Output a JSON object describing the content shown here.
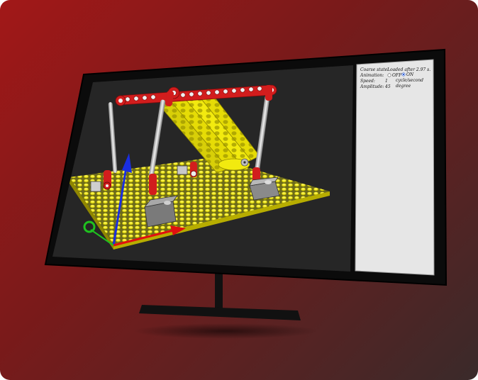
{
  "panel": {
    "status_label": "Coarse state:",
    "status_value": "Loaded after 2.97 s.",
    "animation_label": "Animation:",
    "animation_off": "OFF",
    "animation_on": "ON",
    "animation_selected": "ON",
    "speed_label": "Speed:",
    "speed_value": "1",
    "speed_unit": "cycle/second",
    "amplitude_label": "Amplitude:",
    "amplitude_value": "45",
    "amplitude_unit": "degree"
  },
  "icons": {
    "monitor": "monitor-icon",
    "axis": "axis-gizmo-icon"
  },
  "colors": {
    "background_start": "#a21818",
    "background_end": "#3a2a2a",
    "viewport": "#262626",
    "baseplate": "#f2ea0f",
    "technic_red": "#d21d1d",
    "axis_x": "#e01010",
    "axis_y": "#1a2ee0",
    "axis_z": "#1fc21f"
  }
}
